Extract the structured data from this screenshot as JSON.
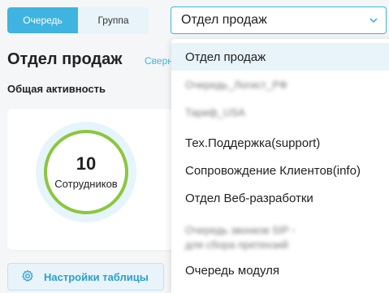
{
  "tabs": {
    "queue_label": "Очередь",
    "group_label": "Группа"
  },
  "select": {
    "value": "Отдел продаж"
  },
  "page": {
    "title": "Отдел продаж",
    "collapse_link": "Сверн",
    "section_title": "Общая активность"
  },
  "activity": {
    "count": "10",
    "count_label": "Сотрудников"
  },
  "settings_button": {
    "label": "Настройки таблицы"
  },
  "dropdown": {
    "options": [
      {
        "label": "Отдел продаж",
        "selected": true
      },
      {
        "label": "Очередь_Логист_РФ",
        "blurred": true
      },
      {
        "label": "Тариф_USA",
        "blurred": true
      },
      {
        "label": "Тех.Поддержка(support)"
      },
      {
        "label": "Сопровождение Клиентов(info)"
      },
      {
        "label": "Отдел Веб-разработки"
      },
      {
        "label_line1": "Очередь звонков SIP -",
        "label_line2": "для сбора претензий",
        "blurred": true
      },
      {
        "label": "Очередь модуля"
      }
    ]
  },
  "colors": {
    "accent": "#3fb4e0",
    "donut_ring": "#8cc63e"
  },
  "icons": {
    "chevron": "chevron-down-icon",
    "gear": "gear-icon"
  }
}
